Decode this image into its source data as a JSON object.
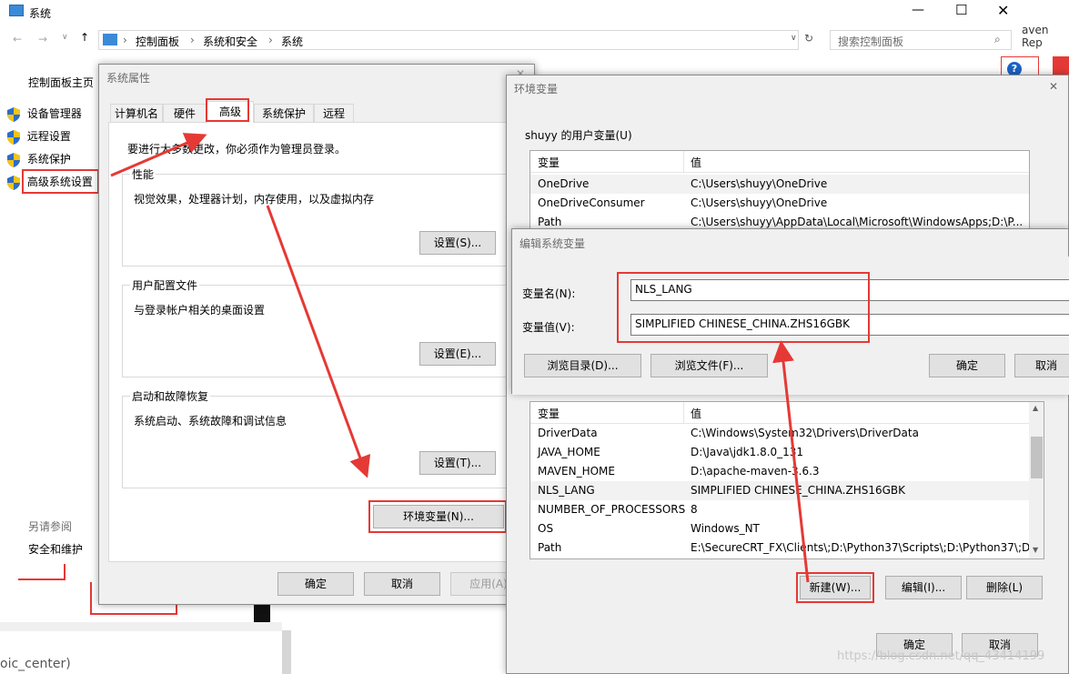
{
  "explorer": {
    "title": "系统",
    "breadcrumb": [
      "控制面板",
      "系统和安全",
      "系统"
    ],
    "search_placeholder": "搜索控制面板",
    "side_home": "控制面板主页",
    "side_links": [
      "设备管理器",
      "远程设置",
      "系统保护",
      "高级系统设置"
    ],
    "see_also": "另请参阅",
    "see_also_link": "安全和维护",
    "bg_right_text": "aven Rep",
    "bg_bottom_text": "oic_center)"
  },
  "sysprops": {
    "title": "系统属性",
    "tabs": [
      "计算机名",
      "硬件",
      "高级",
      "系统保护",
      "远程"
    ],
    "admin_note": "要进行大多数更改，你必须作为管理员登录。",
    "perf_label": "性能",
    "perf_desc": "视觉效果，处理器计划，内存使用，以及虚拟内存",
    "perf_btn": "设置(S)...",
    "profile_label": "用户配置文件",
    "profile_desc": "与登录帐户相关的桌面设置",
    "profile_btn": "设置(E)...",
    "startup_label": "启动和故障恢复",
    "startup_desc": "系统启动、系统故障和调试信息",
    "startup_btn": "设置(T)...",
    "env_btn": "环境变量(N)...",
    "ok": "确定",
    "cancel": "取消",
    "apply": "应用(A)"
  },
  "envvars": {
    "title": "环境变量",
    "user_group": "shuyy 的用户变量(U)",
    "col_var": "变量",
    "col_val": "值",
    "user_rows": [
      {
        "name": "OneDrive",
        "value": "C:\\Users\\shuyy\\OneDrive"
      },
      {
        "name": "OneDriveConsumer",
        "value": "C:\\Users\\shuyy\\OneDrive"
      },
      {
        "name": "Path",
        "value": "C:\\Users\\shuyy\\AppData\\Local\\Microsoft\\WindowsApps;D:\\P..."
      }
    ],
    "sys_rows": [
      {
        "name": "DriverData",
        "value": "C:\\Windows\\System32\\Drivers\\DriverData"
      },
      {
        "name": "JAVA_HOME",
        "value": "D:\\Java\\jdk1.8.0_131"
      },
      {
        "name": "MAVEN_HOME",
        "value": "D:\\apache-maven-3.6.3"
      },
      {
        "name": "NLS_LANG",
        "value": "SIMPLIFIED CHINESE_CHINA.ZHS16GBK"
      },
      {
        "name": "NUMBER_OF_PROCESSORS",
        "value": "8"
      },
      {
        "name": "OS",
        "value": "Windows_NT"
      },
      {
        "name": "Path",
        "value": "E:\\SecureCRT_FX\\Clients\\;D:\\Python37\\Scripts\\;D:\\Python37\\;D..."
      }
    ],
    "new_btn": "新建(W)...",
    "edit_btn": "编辑(I)...",
    "delete_btn": "删除(L)",
    "ok": "确定",
    "cancel": "取消"
  },
  "editvar": {
    "title": "编辑系统变量",
    "name_label": "变量名(N):",
    "name_value": "NLS_LANG",
    "value_label": "变量值(V):",
    "value_value": "SIMPLIFIED CHINESE_CHINA.ZHS16GBK",
    "browse_dir": "浏览目录(D)...",
    "browse_file": "浏览文件(F)...",
    "ok": "确定",
    "cancel": "取消"
  },
  "watermark": "https://blog.csdn.net/qq_43414199"
}
